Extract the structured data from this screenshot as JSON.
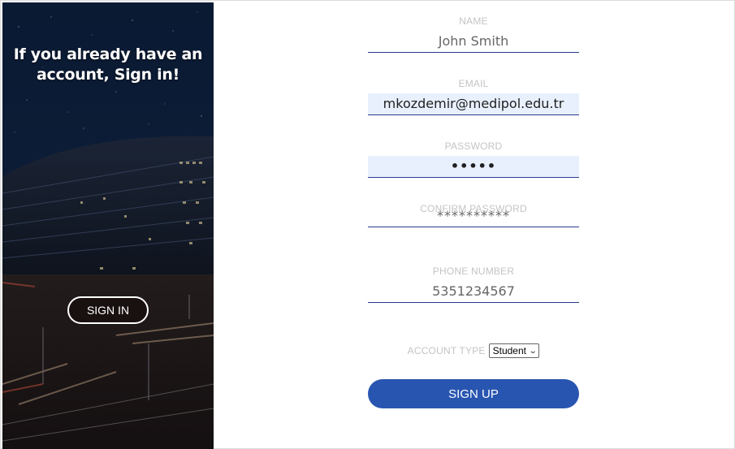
{
  "left_panel": {
    "title": "If you already have an account, Sign in!",
    "signin_label": "SIGN IN"
  },
  "form": {
    "name": {
      "label": "NAME",
      "value": "John Smith"
    },
    "email": {
      "label": "EMAIL",
      "value": "mkozdemir@medipol.edu.tr"
    },
    "password": {
      "label": "PASSWORD",
      "value": "•••••"
    },
    "confirm_password": {
      "label": "CONFIRM PASSWORD",
      "value": "**********"
    },
    "phone": {
      "label": "PHONE NUMBER",
      "value": "5351234567"
    },
    "account_type": {
      "label": "ACCOUNT TYPE",
      "selected": "Student"
    },
    "signup_label": "SIGN UP"
  },
  "colors": {
    "accent": "#2855b0",
    "underline": "#2b3a8e",
    "autofill": "#e8f0fe",
    "label": "#c4c4c4"
  },
  "icons": {
    "select_arrow": "chevron-down-icon"
  }
}
